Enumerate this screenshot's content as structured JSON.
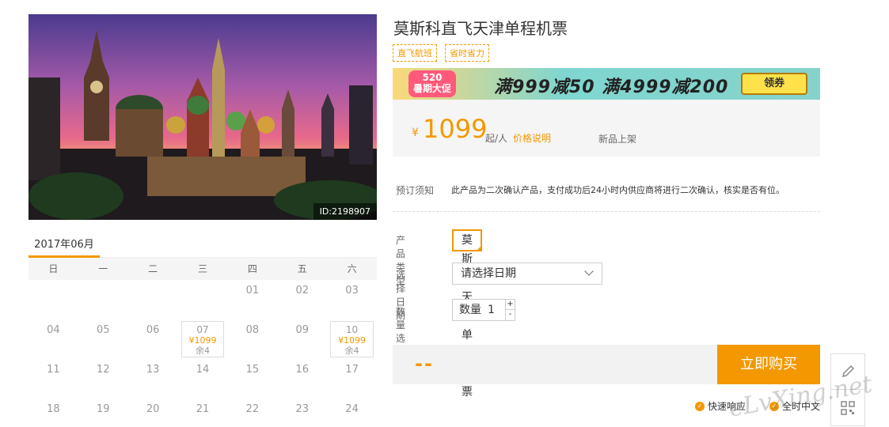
{
  "photo": {
    "id_label": "ID:2198907"
  },
  "calendar": {
    "month": "2017年06月",
    "weekdays": [
      "日",
      "一",
      "二",
      "三",
      "四",
      "五",
      "六"
    ],
    "days": [
      "",
      "",
      "",
      "",
      "01",
      "02",
      "03",
      "04",
      "05",
      "06",
      "07",
      "08",
      "09",
      "10",
      "11",
      "12",
      "13",
      "14",
      "15",
      "16",
      "17",
      "18",
      "19",
      "20",
      "21",
      "22",
      "23",
      "24"
    ],
    "price_days": {
      "07": {
        "price": "¥1099",
        "remain": "余4"
      },
      "10": {
        "price": "¥1099",
        "remain": "余4"
      }
    }
  },
  "product": {
    "title": "莫斯科直飞天津单程机票",
    "tags": [
      "直飞航班",
      "省时省力"
    ]
  },
  "banner": {
    "badge_line1": "520",
    "badge_line2": "暑期大促",
    "promo": "满999减50  满4999减200",
    "coupon": "领券"
  },
  "price": {
    "currency": "¥",
    "value": "1099",
    "unit": "起/人",
    "explain": "价格说明",
    "status": "新品上架"
  },
  "notice": {
    "label": "预订须知",
    "text": "此产品为二次确认产品，支付成功后24小时内供应商将进行二次确认，核实是否有位。"
  },
  "form": {
    "type_label": "产品类型",
    "type_value": "莫斯科天津单程机票",
    "date_label": "选择日期",
    "date_placeholder": "请选择日期",
    "qty_label": "数量选择",
    "qty_name": "数量",
    "qty_value": "1",
    "plus": "+",
    "minus": "-"
  },
  "buy": {
    "total": "--",
    "button": "立即购买"
  },
  "assurances": [
    "快速响应",
    "全时中文"
  ],
  "watermark": "eLvXing.net",
  "colors": {
    "accent": "#f39800"
  }
}
